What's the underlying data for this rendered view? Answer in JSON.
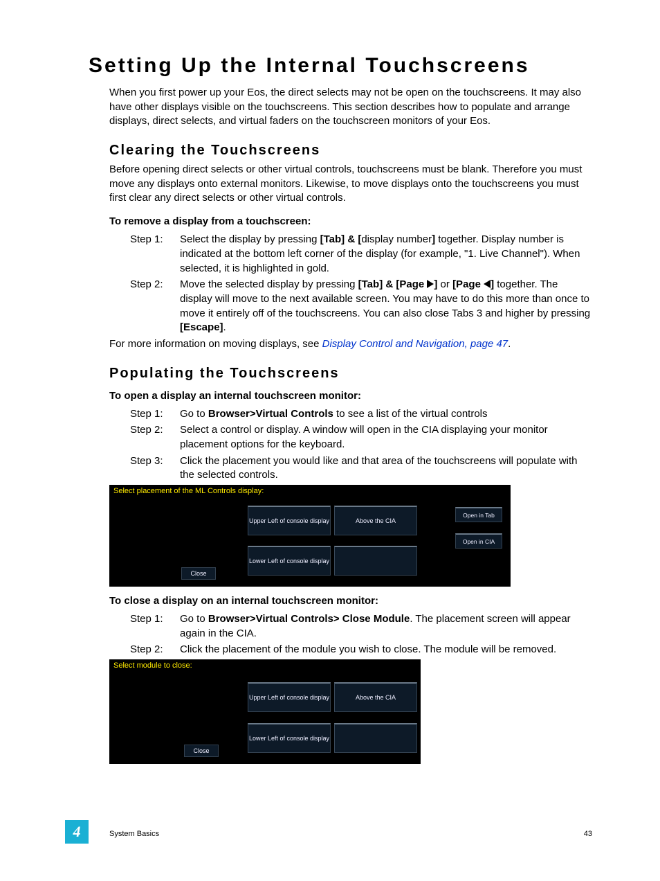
{
  "h1": "Setting Up the Internal Touchscreens",
  "intro": "When you first power up your Eos, the direct selects may not be open on the touchscreens. It may also have other displays visible on the touchscreens. This section describes how to populate and arrange displays, direct selects, and virtual faders on the touchscreen monitors of your Eos.",
  "sec1": {
    "title": "Clearing the Touchscreens",
    "para": "Before opening direct selects or other virtual controls, touchscreens must be blank. Therefore you must move any displays onto external monitors. Likewise, to move displays onto the touchscreens you must first clear any direct selects or other virtual controls.",
    "sub": "To remove a display from a touchscreen:",
    "step1_label": "Step 1:",
    "step1_a": "Select the display by pressing ",
    "step1_b": "[Tab] & [",
    "step1_c": "display number",
    "step1_d": "]",
    "step1_e": " together. Display number is indicated at the bottom left corner of the display (for example, \"1. Live Channel\"). When selected, it is highlighted in gold.",
    "step2_label": "Step 2:",
    "step2_a": "Move the selected display by pressing ",
    "step2_b": "[Tab] & [Page ",
    "step2_c": "]",
    "step2_d": " or ",
    "step2_e": "[Page ",
    "step2_f": "]",
    "step2_g": " together. The display will move to the next available screen. You may have to do this more than once to move it entirely off of the touchscreens. You can also close Tabs 3 and higher by pressing ",
    "step2_h": "[Escape]",
    "step2_i": ".",
    "after_a": "For more information on moving displays, see ",
    "after_link": "Display Control and Navigation, page 47",
    "after_b": "."
  },
  "sec2": {
    "title": "Populating the Touchscreens",
    "subA": "To open a display an internal touchscreen monitor:",
    "a1_label": "Step 1:",
    "a1_a": "Go to ",
    "a1_b": "Browser>Virtual Controls",
    "a1_c": " to see a list of the virtual controls",
    "a2_label": "Step 2:",
    "a2": "Select a control or display. A window will open in the CIA displaying your monitor placement options for the keyboard.",
    "a3_label": "Step 3:",
    "a3": "Click the placement you would like and that area of the touchscreens will populate with the selected controls.",
    "subB": "To close a display on an internal touchscreen monitor:",
    "b1_label": "Step 1:",
    "b1_a": "Go to ",
    "b1_b": "Browser>Virtual Controls> Close Module",
    "b1_c": ". The placement screen will appear again in the CIA.",
    "b2_label": "Step 2:",
    "b2": "Click the placement of the module you wish to close. The module will be removed."
  },
  "panel1": {
    "title": "Select placement of the ML Controls display:",
    "close": "Close",
    "ul": "Upper Left of console display",
    "ll": "Lower Left of console display",
    "above": "Above the CIA",
    "open_tab": "Open in Tab",
    "open_cia": "Open in CIA"
  },
  "panel2": {
    "title": "Select module to close:",
    "close": "Close",
    "ul": "Upper Left of console display",
    "ll": "Lower Left of console display",
    "above": "Above the CIA"
  },
  "footer": {
    "chapter": "4",
    "section": "System Basics",
    "page": "43"
  }
}
